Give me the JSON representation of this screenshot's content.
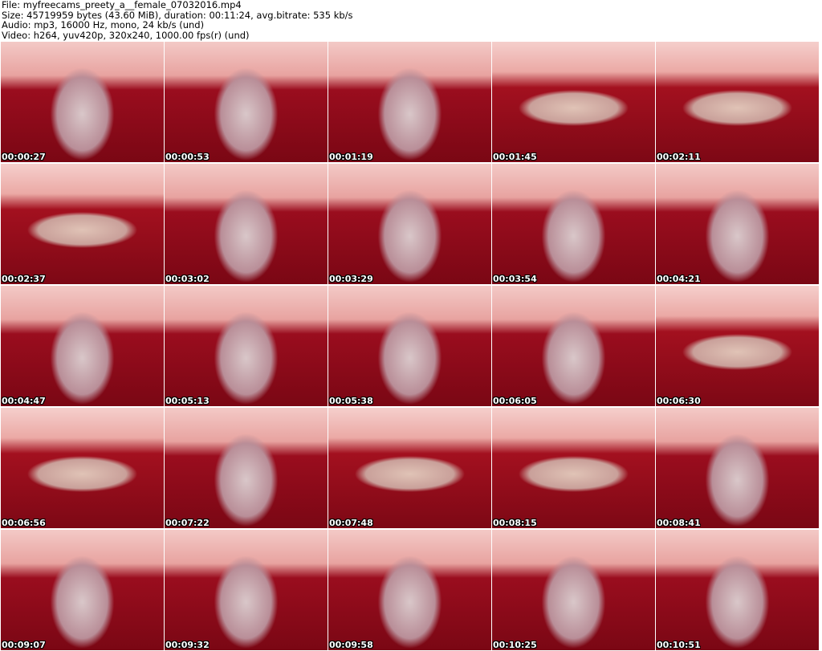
{
  "header": {
    "file": "File: myfreecams_preety_a__female_07032016.mp4",
    "size": "Size: 45719959 bytes (43.60 MiB), duration: 00:11:24, avg.bitrate: 535 kb/s",
    "audio": "Audio: mp3, 16000 Hz, mono, 24 kb/s (und)",
    "video": "Video: h264, yuv420p, 320x240, 1000.00 fps(r) (und)"
  },
  "thumbnails": [
    {
      "time": "00:00:27",
      "pose": "sitting"
    },
    {
      "time": "00:00:53",
      "pose": "sitting"
    },
    {
      "time": "00:01:19",
      "pose": "sitting"
    },
    {
      "time": "00:01:45",
      "pose": "lying"
    },
    {
      "time": "00:02:11",
      "pose": "lying"
    },
    {
      "time": "00:02:37",
      "pose": "lying"
    },
    {
      "time": "00:03:02",
      "pose": "sitting"
    },
    {
      "time": "00:03:29",
      "pose": "sitting"
    },
    {
      "time": "00:03:54",
      "pose": "sitting"
    },
    {
      "time": "00:04:21",
      "pose": "sitting"
    },
    {
      "time": "00:04:47",
      "pose": "sitting"
    },
    {
      "time": "00:05:13",
      "pose": "sitting"
    },
    {
      "time": "00:05:38",
      "pose": "sitting"
    },
    {
      "time": "00:06:05",
      "pose": "sitting"
    },
    {
      "time": "00:06:30",
      "pose": "lying"
    },
    {
      "time": "00:06:56",
      "pose": "lying"
    },
    {
      "time": "00:07:22",
      "pose": "sitting"
    },
    {
      "time": "00:07:48",
      "pose": "lying"
    },
    {
      "time": "00:08:15",
      "pose": "lying"
    },
    {
      "time": "00:08:41",
      "pose": "sitting"
    },
    {
      "time": "00:09:07",
      "pose": "sitting"
    },
    {
      "time": "00:09:32",
      "pose": "sitting"
    },
    {
      "time": "00:09:58",
      "pose": "sitting"
    },
    {
      "time": "00:10:25",
      "pose": "sitting"
    },
    {
      "time": "00:10:51",
      "pose": "sitting"
    }
  ]
}
